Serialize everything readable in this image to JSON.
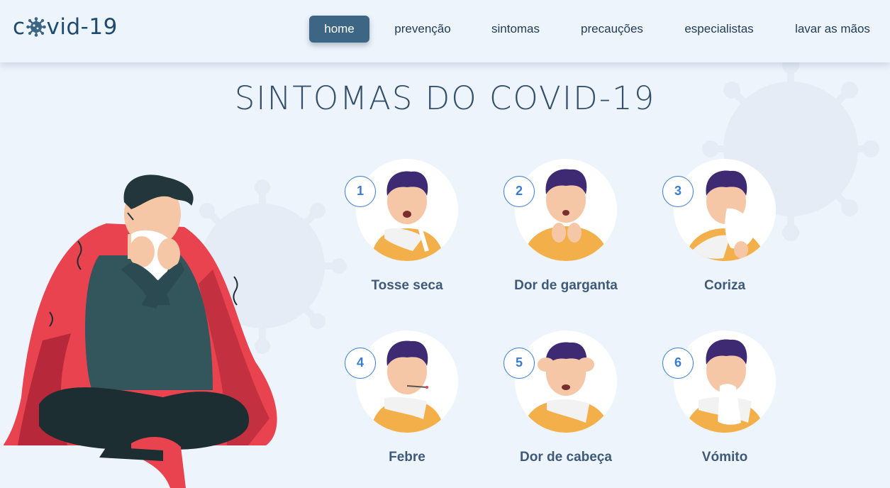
{
  "logo": {
    "prefix": "c",
    "suffix": "vid-19",
    "icon": "virus-icon"
  },
  "nav": {
    "items": [
      {
        "label": "home",
        "active": true
      },
      {
        "label": "prevenção",
        "active": false
      },
      {
        "label": "sintomas",
        "active": false
      },
      {
        "label": "precauções",
        "active": false
      },
      {
        "label": "especialistas",
        "active": false
      },
      {
        "label": "lavar as mãos",
        "active": false
      }
    ]
  },
  "title": "SINTOMAS DO COVID-19",
  "symptoms": [
    {
      "number": "1",
      "label": "Tosse seca"
    },
    {
      "number": "2",
      "label": "Dor de garganta"
    },
    {
      "number": "3",
      "label": "Coriza"
    },
    {
      "number": "4",
      "label": "Febre"
    },
    {
      "number": "5",
      "label": "Dor de cabeça"
    },
    {
      "number": "6",
      "label": "Vómito"
    }
  ],
  "colors": {
    "background": "#eef4fc",
    "nav_active": "#3d6584",
    "accent_blue": "#3a7bd5",
    "title": "#34506b",
    "blanket": "#e8434e",
    "shirt": "#f3b04a"
  }
}
